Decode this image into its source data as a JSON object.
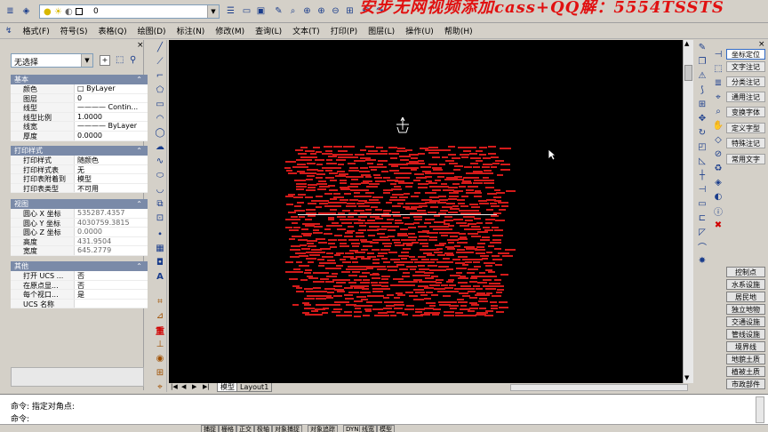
{
  "banner": "安步无网视频添加cass+QQ解：5554TSSTS",
  "toolbar": {
    "layer_value": "0"
  },
  "menubar": {
    "items": [
      "格式(F)",
      "符号(S)",
      "表格(Q)",
      "绘图(D)",
      "标注(N)",
      "修改(M)",
      "查询(L)",
      "文本(T)",
      "打印(P)",
      "图层(L)",
      "操作(U)",
      "帮助(H)"
    ]
  },
  "props": {
    "select_value": "无选择",
    "sections": [
      {
        "title": "基本",
        "rows": [
          {
            "k": "颜色",
            "v": "□ ByLayer"
          },
          {
            "k": "图层",
            "v": "0"
          },
          {
            "k": "线型",
            "v": "———— Contin..."
          },
          {
            "k": "线型比例",
            "v": "1.0000"
          },
          {
            "k": "线宽",
            "v": "———— ByLayer"
          },
          {
            "k": "厚度",
            "v": "0.0000"
          }
        ]
      },
      {
        "title": "打印样式",
        "rows": [
          {
            "k": "打印样式",
            "v": "随颜色"
          },
          {
            "k": "打印样式表",
            "v": "无"
          },
          {
            "k": "打印表附着到",
            "v": "模型"
          },
          {
            "k": "打印表类型",
            "v": "不可用"
          }
        ]
      },
      {
        "title": "视图",
        "rows": [
          {
            "k": "圆心 X 坐标",
            "v": "535287.4357"
          },
          {
            "k": "圆心 Y 坐标",
            "v": "4030759.3815"
          },
          {
            "k": "圆心 Z 坐标",
            "v": "0.0000"
          },
          {
            "k": "高度",
            "v": "431.9504"
          },
          {
            "k": "宽度",
            "v": "645.2779"
          }
        ]
      },
      {
        "title": "其他",
        "rows": [
          {
            "k": "打开 UCS ...",
            "v": "否"
          },
          {
            "k": "在原点显...",
            "v": "否"
          },
          {
            "k": "每个视口...",
            "v": "是"
          },
          {
            "k": "UCS 名称",
            "v": ""
          }
        ]
      }
    ]
  },
  "tabs": {
    "model": "模型",
    "layout1": "Layout1"
  },
  "right_panel": {
    "top_items": [
      "坐标定位",
      "文字注记",
      "分类注记",
      "通用注记",
      "变换字体",
      "定义字型",
      "特殊注记",
      "常用文字"
    ],
    "bottom_items": [
      "控制点",
      "水系设施",
      "居民地",
      "独立地物",
      "交通设施",
      "管线设施",
      "境界线",
      "地貌土质",
      "植被土质",
      "市政部件"
    ]
  },
  "command": {
    "line1": "命令: 指定对角点:",
    "line2": "命令:"
  },
  "status": {
    "buttons": [
      "捕捉",
      "栅格",
      "正交",
      "极轴",
      "对象捕捉",
      "对象追踪",
      "DYN",
      "线宽",
      "模型"
    ]
  }
}
